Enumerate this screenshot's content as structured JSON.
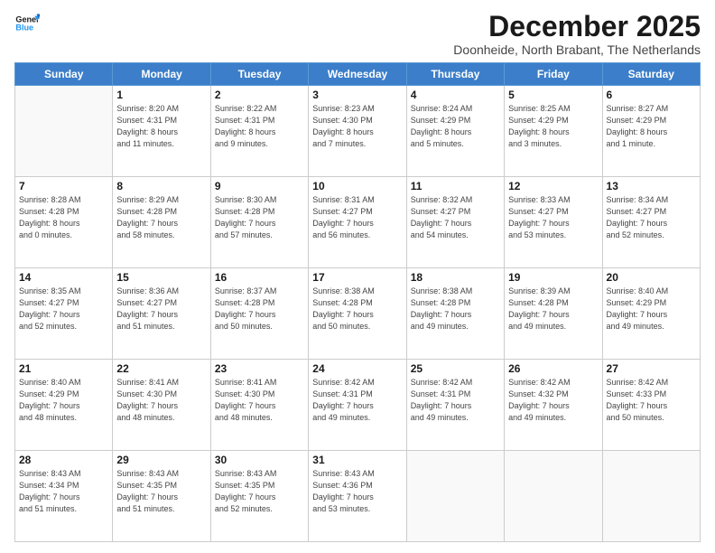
{
  "logo": {
    "line1": "General",
    "line2": "Blue"
  },
  "title": "December 2025",
  "subtitle": "Doonheide, North Brabant, The Netherlands",
  "weekdays": [
    "Sunday",
    "Monday",
    "Tuesday",
    "Wednesday",
    "Thursday",
    "Friday",
    "Saturday"
  ],
  "weeks": [
    [
      {
        "day": "",
        "info": ""
      },
      {
        "day": "1",
        "info": "Sunrise: 8:20 AM\nSunset: 4:31 PM\nDaylight: 8 hours\nand 11 minutes."
      },
      {
        "day": "2",
        "info": "Sunrise: 8:22 AM\nSunset: 4:31 PM\nDaylight: 8 hours\nand 9 minutes."
      },
      {
        "day": "3",
        "info": "Sunrise: 8:23 AM\nSunset: 4:30 PM\nDaylight: 8 hours\nand 7 minutes."
      },
      {
        "day": "4",
        "info": "Sunrise: 8:24 AM\nSunset: 4:29 PM\nDaylight: 8 hours\nand 5 minutes."
      },
      {
        "day": "5",
        "info": "Sunrise: 8:25 AM\nSunset: 4:29 PM\nDaylight: 8 hours\nand 3 minutes."
      },
      {
        "day": "6",
        "info": "Sunrise: 8:27 AM\nSunset: 4:29 PM\nDaylight: 8 hours\nand 1 minute."
      }
    ],
    [
      {
        "day": "7",
        "info": "Sunrise: 8:28 AM\nSunset: 4:28 PM\nDaylight: 8 hours\nand 0 minutes."
      },
      {
        "day": "8",
        "info": "Sunrise: 8:29 AM\nSunset: 4:28 PM\nDaylight: 7 hours\nand 58 minutes."
      },
      {
        "day": "9",
        "info": "Sunrise: 8:30 AM\nSunset: 4:28 PM\nDaylight: 7 hours\nand 57 minutes."
      },
      {
        "day": "10",
        "info": "Sunrise: 8:31 AM\nSunset: 4:27 PM\nDaylight: 7 hours\nand 56 minutes."
      },
      {
        "day": "11",
        "info": "Sunrise: 8:32 AM\nSunset: 4:27 PM\nDaylight: 7 hours\nand 54 minutes."
      },
      {
        "day": "12",
        "info": "Sunrise: 8:33 AM\nSunset: 4:27 PM\nDaylight: 7 hours\nand 53 minutes."
      },
      {
        "day": "13",
        "info": "Sunrise: 8:34 AM\nSunset: 4:27 PM\nDaylight: 7 hours\nand 52 minutes."
      }
    ],
    [
      {
        "day": "14",
        "info": "Sunrise: 8:35 AM\nSunset: 4:27 PM\nDaylight: 7 hours\nand 52 minutes."
      },
      {
        "day": "15",
        "info": "Sunrise: 8:36 AM\nSunset: 4:27 PM\nDaylight: 7 hours\nand 51 minutes."
      },
      {
        "day": "16",
        "info": "Sunrise: 8:37 AM\nSunset: 4:28 PM\nDaylight: 7 hours\nand 50 minutes."
      },
      {
        "day": "17",
        "info": "Sunrise: 8:38 AM\nSunset: 4:28 PM\nDaylight: 7 hours\nand 50 minutes."
      },
      {
        "day": "18",
        "info": "Sunrise: 8:38 AM\nSunset: 4:28 PM\nDaylight: 7 hours\nand 49 minutes."
      },
      {
        "day": "19",
        "info": "Sunrise: 8:39 AM\nSunset: 4:28 PM\nDaylight: 7 hours\nand 49 minutes."
      },
      {
        "day": "20",
        "info": "Sunrise: 8:40 AM\nSunset: 4:29 PM\nDaylight: 7 hours\nand 49 minutes."
      }
    ],
    [
      {
        "day": "21",
        "info": "Sunrise: 8:40 AM\nSunset: 4:29 PM\nDaylight: 7 hours\nand 48 minutes."
      },
      {
        "day": "22",
        "info": "Sunrise: 8:41 AM\nSunset: 4:30 PM\nDaylight: 7 hours\nand 48 minutes."
      },
      {
        "day": "23",
        "info": "Sunrise: 8:41 AM\nSunset: 4:30 PM\nDaylight: 7 hours\nand 48 minutes."
      },
      {
        "day": "24",
        "info": "Sunrise: 8:42 AM\nSunset: 4:31 PM\nDaylight: 7 hours\nand 49 minutes."
      },
      {
        "day": "25",
        "info": "Sunrise: 8:42 AM\nSunset: 4:31 PM\nDaylight: 7 hours\nand 49 minutes."
      },
      {
        "day": "26",
        "info": "Sunrise: 8:42 AM\nSunset: 4:32 PM\nDaylight: 7 hours\nand 49 minutes."
      },
      {
        "day": "27",
        "info": "Sunrise: 8:42 AM\nSunset: 4:33 PM\nDaylight: 7 hours\nand 50 minutes."
      }
    ],
    [
      {
        "day": "28",
        "info": "Sunrise: 8:43 AM\nSunset: 4:34 PM\nDaylight: 7 hours\nand 51 minutes."
      },
      {
        "day": "29",
        "info": "Sunrise: 8:43 AM\nSunset: 4:35 PM\nDaylight: 7 hours\nand 51 minutes."
      },
      {
        "day": "30",
        "info": "Sunrise: 8:43 AM\nSunset: 4:35 PM\nDaylight: 7 hours\nand 52 minutes."
      },
      {
        "day": "31",
        "info": "Sunrise: 8:43 AM\nSunset: 4:36 PM\nDaylight: 7 hours\nand 53 minutes."
      },
      {
        "day": "",
        "info": ""
      },
      {
        "day": "",
        "info": ""
      },
      {
        "day": "",
        "info": ""
      }
    ]
  ]
}
